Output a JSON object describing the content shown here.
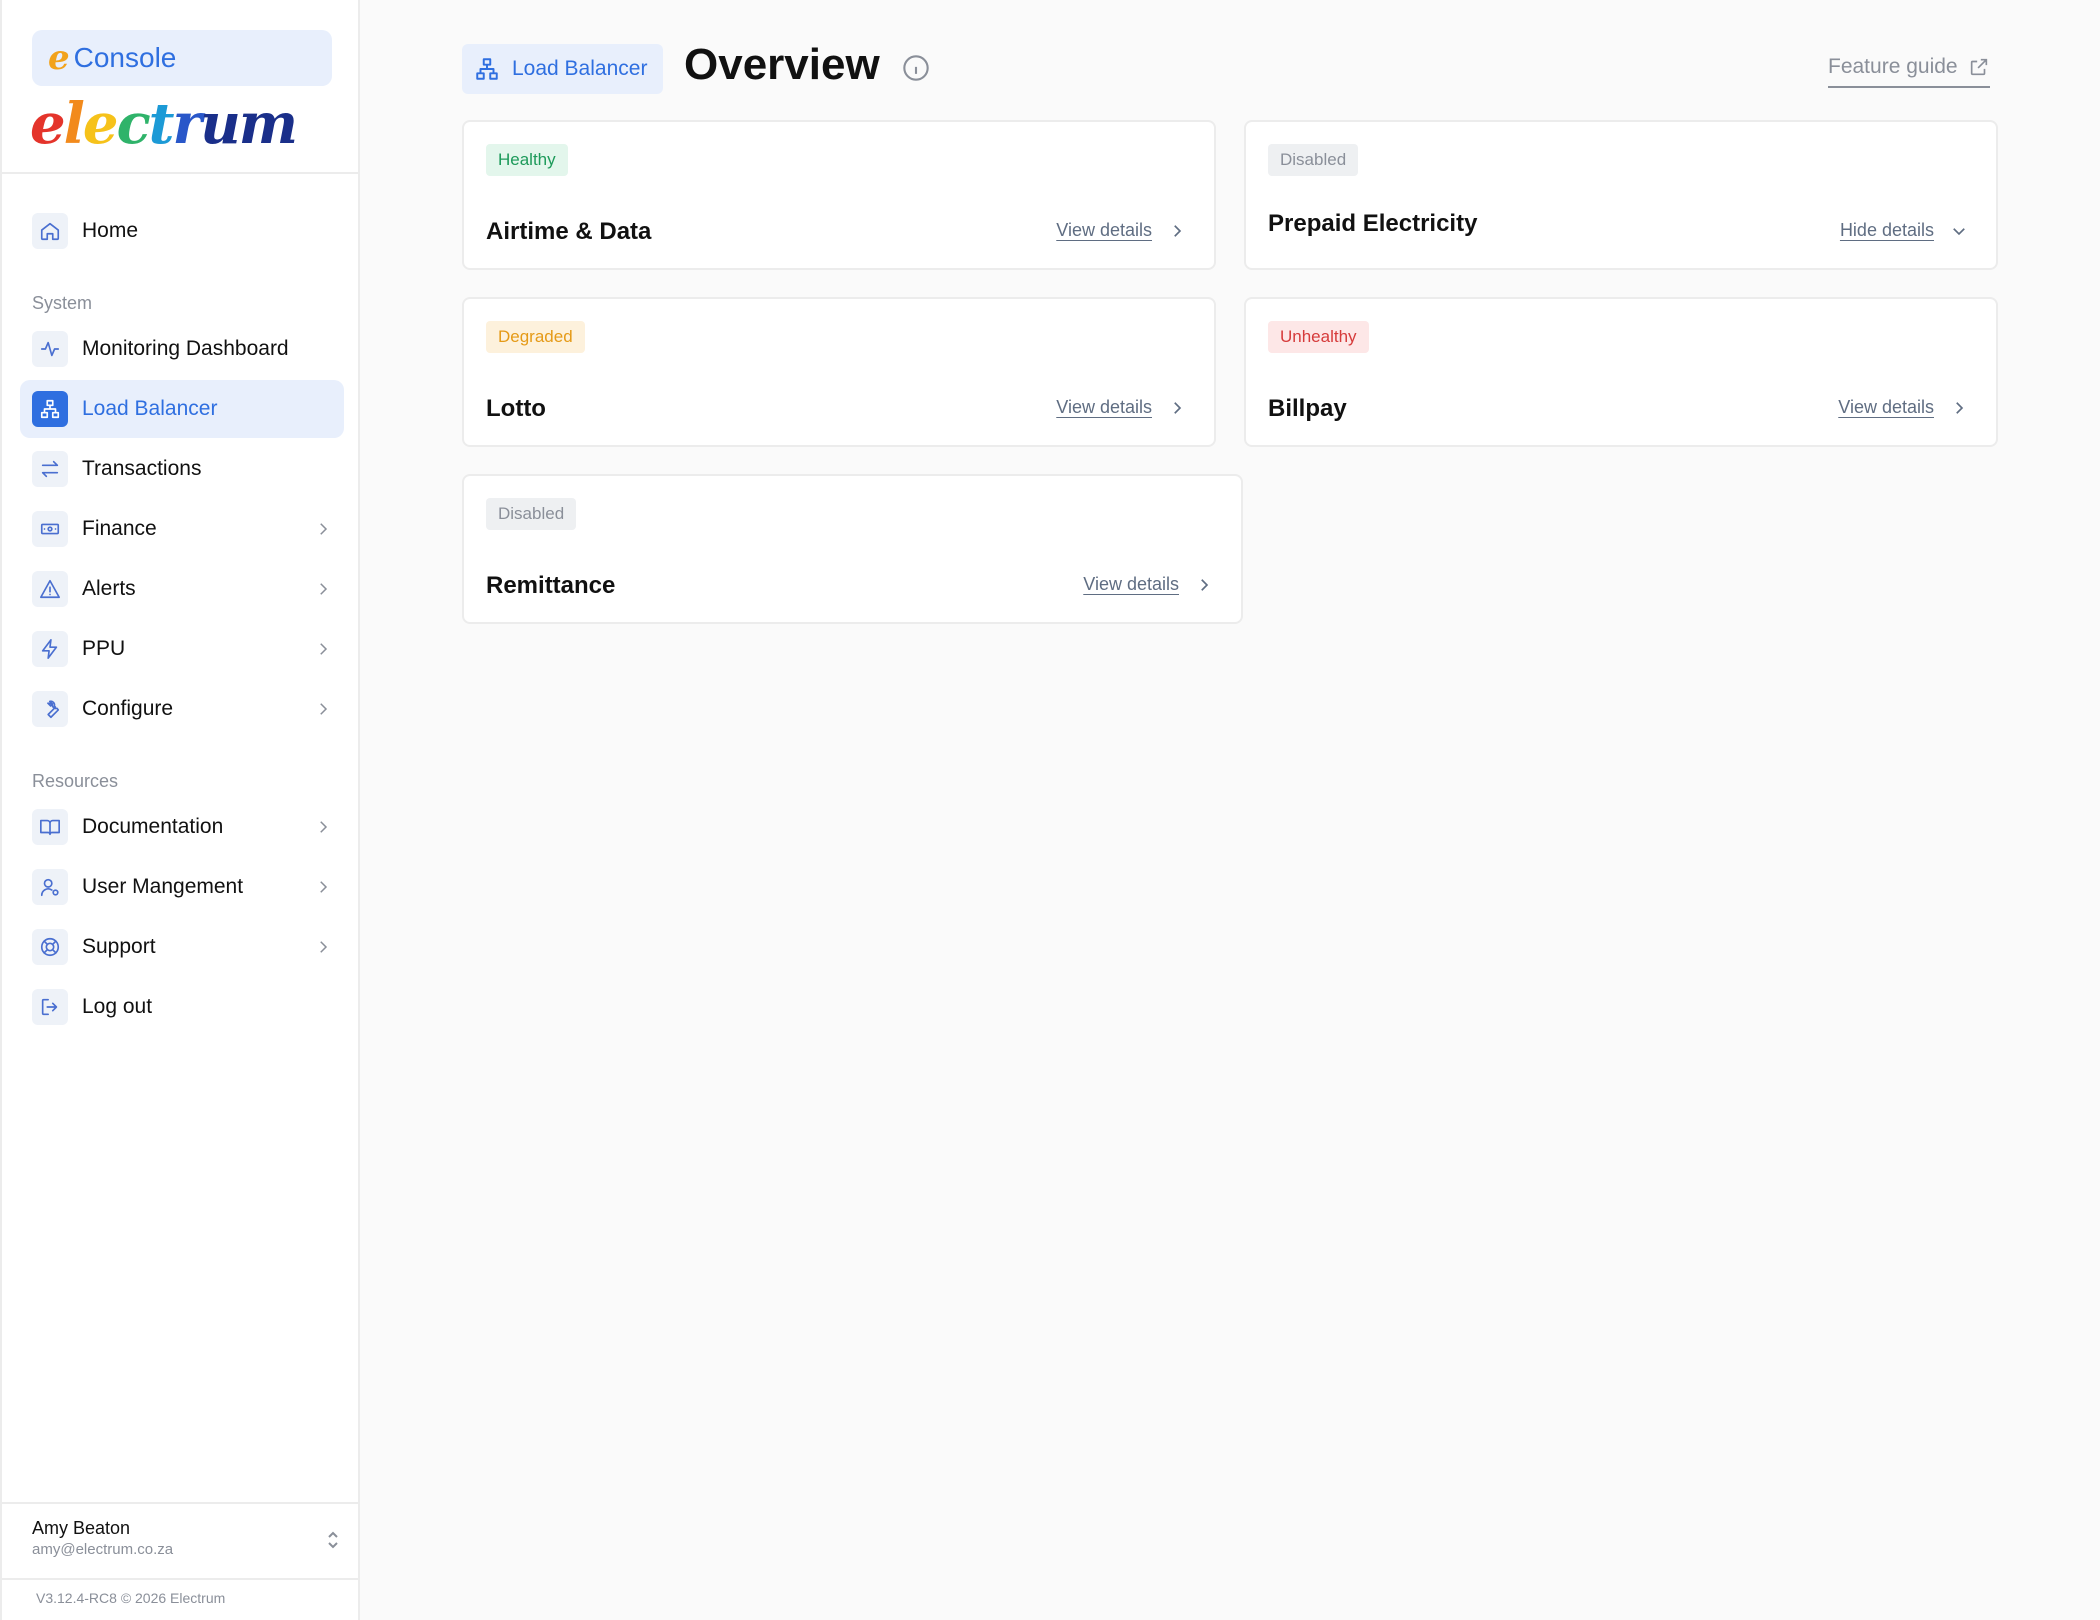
{
  "brand": {
    "console_label": "Console",
    "logo_text": "electrum",
    "logo_mark": "e"
  },
  "sidebar": {
    "home": {
      "label": "Home",
      "icon": "home-icon"
    },
    "system_label": "System",
    "system_items": [
      {
        "label": "Monitoring Dashboard",
        "icon": "activity-icon",
        "chevron": false
      },
      {
        "label": "Load Balancer",
        "icon": "network-icon",
        "chevron": false,
        "active": true
      },
      {
        "label": "Transactions",
        "icon": "transfer-icon",
        "chevron": false
      },
      {
        "label": "Finance",
        "icon": "banknote-icon",
        "chevron": true
      },
      {
        "label": "Alerts",
        "icon": "alert-triangle-icon",
        "chevron": true
      },
      {
        "label": "PPU",
        "icon": "lightning-icon",
        "chevron": true
      },
      {
        "label": "Configure",
        "icon": "wrench-icon",
        "chevron": true
      }
    ],
    "resources_label": "Resources",
    "resource_items": [
      {
        "label": "Documentation",
        "icon": "book-icon",
        "chevron": true
      },
      {
        "label": "User Mangement",
        "icon": "user-cog-icon",
        "chevron": true
      },
      {
        "label": "Support",
        "icon": "lifebuoy-icon",
        "chevron": true
      },
      {
        "label": "Log out",
        "icon": "logout-icon",
        "chevron": false
      }
    ],
    "user": {
      "name": "Amy Beaton",
      "email": "amy@electrum.co.za"
    },
    "version": "V3.12.4-RC8 © 2026 Electrum"
  },
  "header": {
    "breadcrumb": "Load Balancer",
    "title": "Overview",
    "feature_guide": "Feature guide"
  },
  "cards": [
    {
      "status": "Healthy",
      "status_kind": "healthy",
      "title": "Airtime & Data",
      "link": "View details",
      "expanded": false
    },
    {
      "status": "Disabled",
      "status_kind": "disabled",
      "title": "Prepaid Electricity",
      "link": "Hide details",
      "expanded": true
    },
    {
      "status": "Degraded",
      "status_kind": "degraded",
      "title": "Lotto",
      "link": "View details",
      "expanded": false
    },
    {
      "status": "Unhealthy",
      "status_kind": "unhealthy",
      "title": "Billpay",
      "link": "View details",
      "expanded": false
    },
    {
      "status": "Disabled",
      "status_kind": "disabled",
      "title": "Remittance",
      "link": "View details",
      "expanded": false
    }
  ],
  "colors": {
    "accent": "#2f6fe0",
    "healthy": "#1d9a5a",
    "degraded": "#e59a17",
    "unhealthy": "#d63b3b",
    "muted": "#8a8f99"
  }
}
